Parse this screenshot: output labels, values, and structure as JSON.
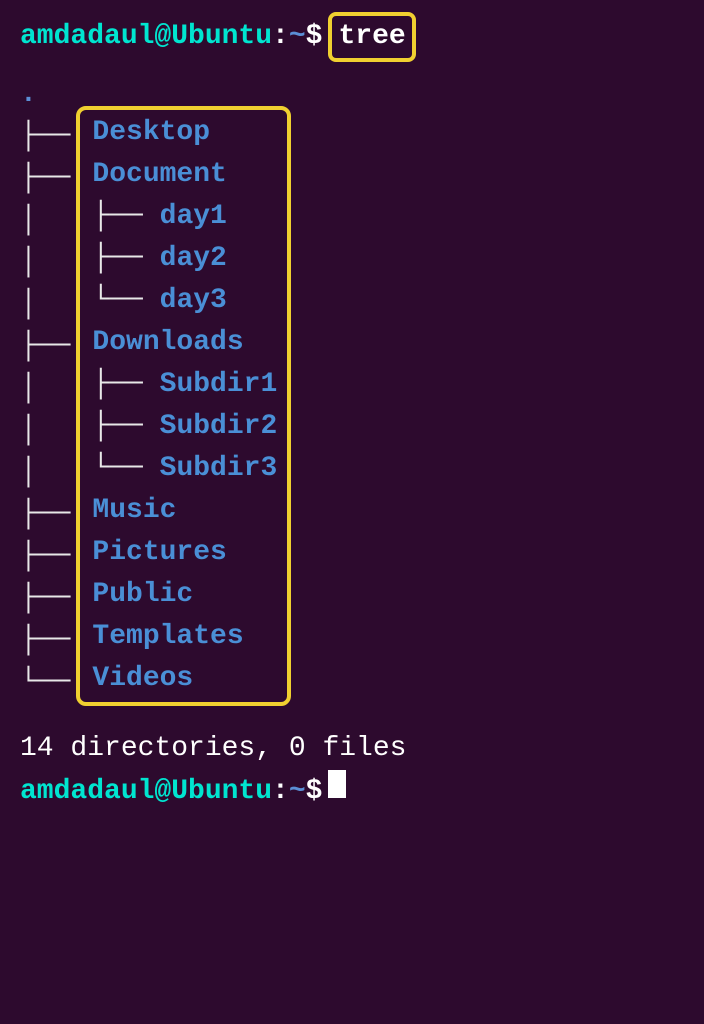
{
  "prompt": {
    "user_host": "amdadaul@Ubuntu",
    "sep": ":",
    "path": "~",
    "sigil": "$"
  },
  "command": "tree",
  "tree": {
    "dot": ".",
    "branches_left": "├──\n├──\n│  \n│  \n│  \n├──\n│  \n│  \n│  \n├──\n├──\n├──\n├──\n└──",
    "items": [
      {
        "label": "Desktop"
      },
      {
        "label": "Document"
      },
      {
        "prefix": "├── ",
        "label": "day1"
      },
      {
        "prefix": "├── ",
        "label": "day2"
      },
      {
        "prefix": "└── ",
        "label": "day3"
      },
      {
        "label": "Downloads"
      },
      {
        "prefix": "├── ",
        "label": "Subdir1"
      },
      {
        "prefix": "├── ",
        "label": "Subdir2"
      },
      {
        "prefix": "└── ",
        "label": "Subdir3"
      },
      {
        "label": "Music"
      },
      {
        "label": "Pictures"
      },
      {
        "label": "Public"
      },
      {
        "label": "Templates"
      },
      {
        "label": "Videos"
      }
    ]
  },
  "summary": "14 directories, 0 files"
}
